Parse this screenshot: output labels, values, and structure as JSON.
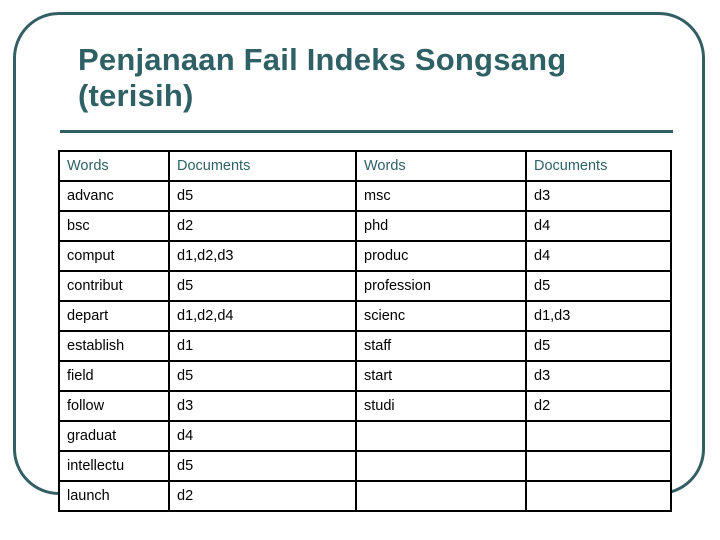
{
  "slide": {
    "title": "Penjanaan Fail Indeks Songsang\n(terisih)",
    "title_color": "#2e6065",
    "frame_color": "#335e63",
    "rule_color": "#335e63",
    "background": "#ffffff"
  },
  "table": {
    "headers": [
      "Words",
      "Documents",
      "Words",
      "Documents"
    ],
    "rows": [
      [
        "advanc",
        "d5",
        "msc",
        "d3"
      ],
      [
        "bsc",
        "d2",
        "phd",
        "d4"
      ],
      [
        "comput",
        "d1,d2,d3",
        "produc",
        "d4"
      ],
      [
        "contribut",
        "d5",
        "profession",
        "d5"
      ],
      [
        "depart",
        "d1,d2,d4",
        "scienc",
        "d1,d3"
      ],
      [
        "establish",
        "d1",
        "staff",
        "d5"
      ],
      [
        "field",
        "d5",
        "start",
        "d3"
      ],
      [
        "follow",
        "d3",
        "studi",
        "d2"
      ],
      [
        "graduat",
        "d4",
        "",
        ""
      ],
      [
        "intellectu",
        "d5",
        "",
        ""
      ],
      [
        "launch",
        "d2",
        "",
        ""
      ]
    ]
  }
}
